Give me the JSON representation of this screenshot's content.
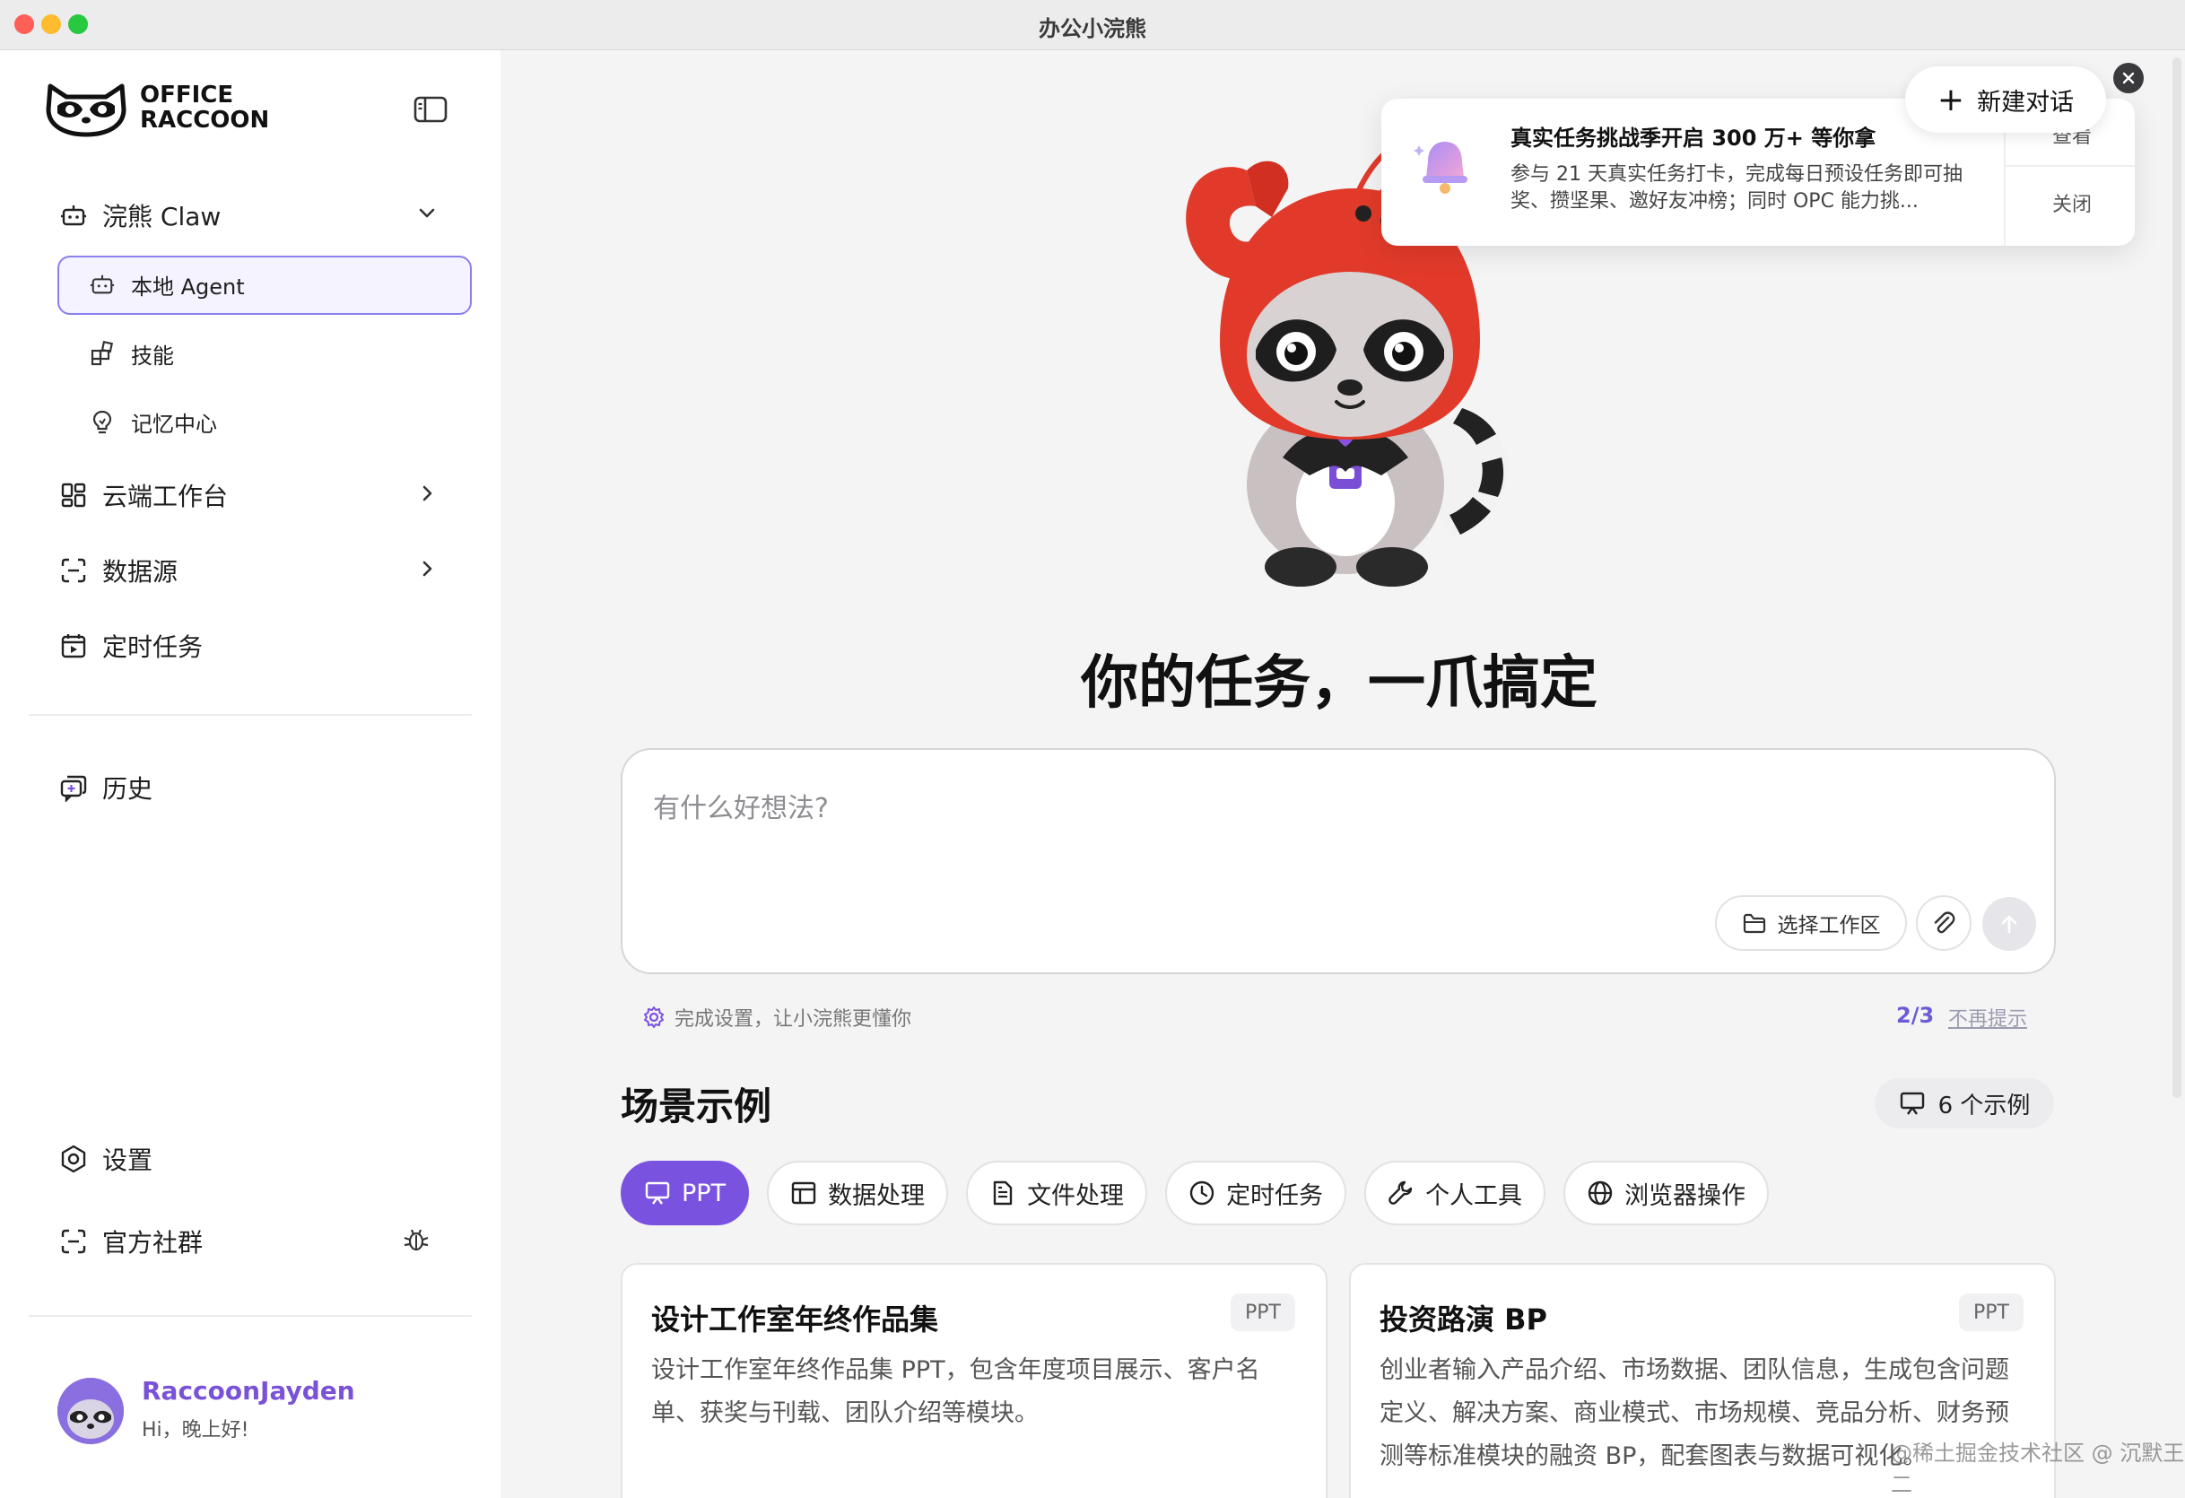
{
  "window": {
    "title": "办公小浣熊"
  },
  "traffic_lights": {
    "close": "#fe5f57",
    "minimize": "#febc2e",
    "maximize": "#28c840"
  },
  "brand": {
    "line1": "OFFICE",
    "line2": "RACCOON"
  },
  "sidebar": {
    "claw": {
      "label": "浣熊 Claw"
    },
    "claw_items": [
      {
        "label": "本地 Agent",
        "icon": "robot-icon"
      },
      {
        "label": "技能",
        "icon": "skills-icon"
      },
      {
        "label": "记忆中心",
        "icon": "bulb-icon"
      }
    ],
    "cloud": {
      "label": "云端工作台"
    },
    "datasource": {
      "label": "数据源"
    },
    "scheduled": {
      "label": "定时任务"
    },
    "history": {
      "label": "历史"
    },
    "settings": {
      "label": "设置"
    },
    "community": {
      "label": "官方社群"
    }
  },
  "user": {
    "name": "RaccoonJayden",
    "greeting": "Hi，晚上好!"
  },
  "main": {
    "headline": "你的任务，一爪搞定",
    "input": {
      "placeholder": "有什么好想法?"
    },
    "workspace_button": "选择工作区",
    "setup_hint": "完成设置，让小浣熊更懂你",
    "setup_progress": "2/3",
    "dismiss_hint": "不再提示",
    "section_title": "场景示例",
    "examples_count": "6 个示例",
    "tabs": [
      {
        "label": "PPT",
        "icon": "presentation-icon"
      },
      {
        "label": "数据处理",
        "icon": "table-icon"
      },
      {
        "label": "文件处理",
        "icon": "document-icon"
      },
      {
        "label": "定时任务",
        "icon": "clock-icon"
      },
      {
        "label": "个人工具",
        "icon": "wrench-icon"
      },
      {
        "label": "浏览器操作",
        "icon": "globe-icon"
      }
    ],
    "cards": [
      {
        "title": "设计工作室年终作品集",
        "badge": "PPT",
        "body": "设计工作室年终作品集 PPT，包含年度项目展示、客户名单、获奖与刊载、团队介绍等模块。"
      },
      {
        "title": "投资路演 BP",
        "badge": "PPT",
        "body": "创业者输入产品介绍、市场数据、团队信息，生成包含问题定义、解决方案、商业模式、市场规模、竞品分析、财务预测等标准模块的融资 BP，配套图表与数据可视化。"
      }
    ]
  },
  "notification": {
    "title": "真实任务挑战季开启 300 万+ 等你拿",
    "body": "参与 21 天真实任务打卡，完成每日预设任务即可抽奖、攒坚果、邀好友冲榜；同时 OPC 能力挑...",
    "view": "查看",
    "close": "关闭"
  },
  "new_chat": {
    "label": "新建对话"
  },
  "watermark": "@稀土掘金技术社区 @ 沉默王二",
  "colors": {
    "accent": "#7a52e0",
    "active_border": "#8a7ff0",
    "active_bg": "#f5f3ff"
  }
}
